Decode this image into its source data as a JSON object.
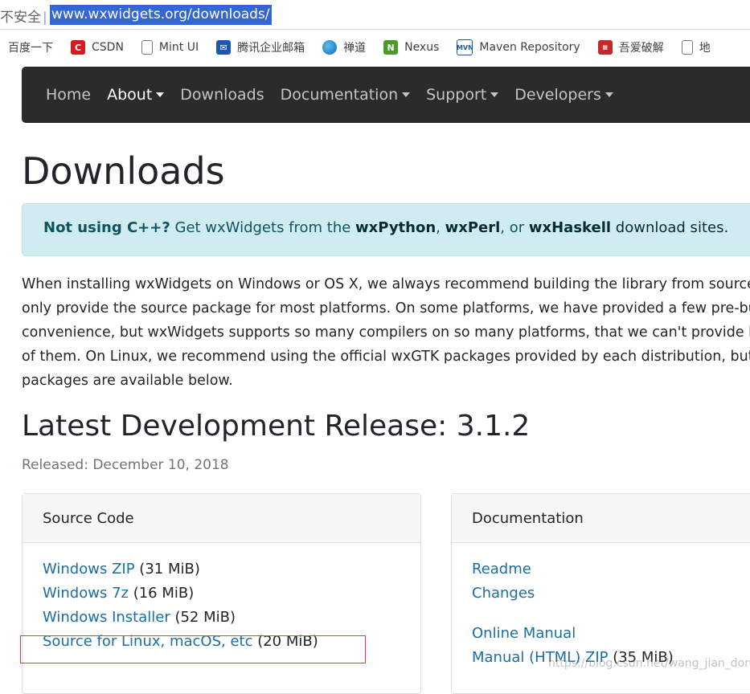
{
  "address_bar": {
    "security": "不安全",
    "separator": "|",
    "url": "www.wxwidgets.org/downloads/"
  },
  "bookmarks": [
    {
      "label": "百度一下",
      "icon": "none"
    },
    {
      "label": "CSDN",
      "icon": "csdn-icon"
    },
    {
      "label": "Mint UI",
      "icon": "document-icon"
    },
    {
      "label": "腾讯企业邮箱",
      "icon": "tencent-mail-icon"
    },
    {
      "label": "禅道",
      "icon": "globe-icon"
    },
    {
      "label": "Nexus",
      "icon": "nexus-icon"
    },
    {
      "label": "Maven Repository",
      "icon": "mvn-icon"
    },
    {
      "label": "吾爱破解",
      "icon": "52pojie-icon"
    },
    {
      "label": "地",
      "icon": "document-icon"
    }
  ],
  "nav": {
    "items": [
      {
        "label": "Home",
        "dropdown": false
      },
      {
        "label": "About",
        "dropdown": true
      },
      {
        "label": "Downloads",
        "dropdown": false
      },
      {
        "label": "Documentation",
        "dropdown": true
      },
      {
        "label": "Support",
        "dropdown": true
      },
      {
        "label": "Developers",
        "dropdown": true
      }
    ]
  },
  "page": {
    "title": "Downloads",
    "alert": {
      "lead": "Not using C++?",
      "text1": " Get wxWidgets from the ",
      "link1": "wxPython",
      "comma1": ", ",
      "link2": "wxPerl",
      "or": ", or ",
      "link3": "wxHaskell",
      "link4": " download sites."
    },
    "intro": [
      "When installing wxWidgets on Windows or OS X, we always recommend building the library from source",
      "only provide the source package for most platforms. On some platforms, we have provided a few pre-bu",
      "convenience, but wxWidgets supports so many compilers on so many platforms, that we can't provide bi",
      "of them. On Linux, we recommend using the official wxGTK packages provided by each distribution, but r",
      "packages are available below."
    ],
    "release_title": "Latest Development Release: 3.1.2",
    "released": "Released: December 10, 2018"
  },
  "source_card": {
    "header": "Source Code",
    "items": [
      {
        "label": "Windows ZIP",
        "size": " (31 MiB)"
      },
      {
        "label": "Windows 7z",
        "size": " (16 MiB)"
      },
      {
        "label": "Windows Installer",
        "size": " (52 MiB)"
      },
      {
        "label": "Source for Linux, macOS, etc",
        "size": " (20 MiB)"
      }
    ]
  },
  "doc_card": {
    "header": "Documentation",
    "items": [
      {
        "label": "Readme"
      },
      {
        "label": "Changes"
      },
      {
        "label": "Online Manual"
      },
      {
        "label": "Manual (HTML) ZIP",
        "size": " (35 MiB)"
      }
    ]
  },
  "watermark": "https://blog.csdn.net/wang_jian_dong",
  "colors": {
    "navbar_bg": "#2b2b2b",
    "alert_bg": "#d1ecf1",
    "link": "#1a6ea0",
    "highlight": "#e53935",
    "url_selection": "#3367d6"
  }
}
